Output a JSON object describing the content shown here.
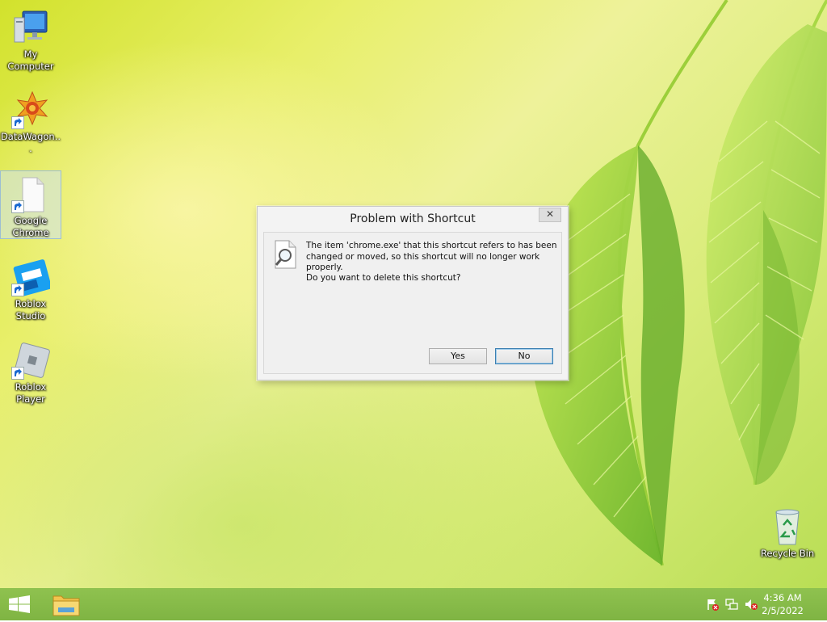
{
  "desktop": {
    "icons": [
      {
        "label": "My Computer",
        "icon": "computer-icon"
      },
      {
        "label": "DataWagon...",
        "icon": "datawagon-icon"
      },
      {
        "label": "Google Chrome",
        "icon": "blank-file-icon"
      },
      {
        "label": "Roblox Studio",
        "icon": "roblox-studio-icon"
      },
      {
        "label": "Roblox Player",
        "icon": "roblox-player-icon"
      },
      {
        "label": "Recycle Bin",
        "icon": "recycle-bin-icon"
      }
    ]
  },
  "dialog": {
    "title": "Problem with Shortcut",
    "close_glyph": "✕",
    "message": "The item 'chrome.exe' that this shortcut refers to has been changed or moved, so this shortcut will no longer work properly.",
    "question": "Do you want to delete this shortcut?",
    "yes_label": "Yes",
    "no_label": "No"
  },
  "taskbar": {
    "time": "4:36 AM",
    "date": "2/5/2022",
    "tray_icons": [
      "action-center-flag-icon",
      "network-icon",
      "volume-muted-icon"
    ]
  },
  "colors": {
    "taskbar": "#8fc24f",
    "dialog_bg": "#f0f0f0",
    "default_button_border": "#3c7fb1"
  }
}
